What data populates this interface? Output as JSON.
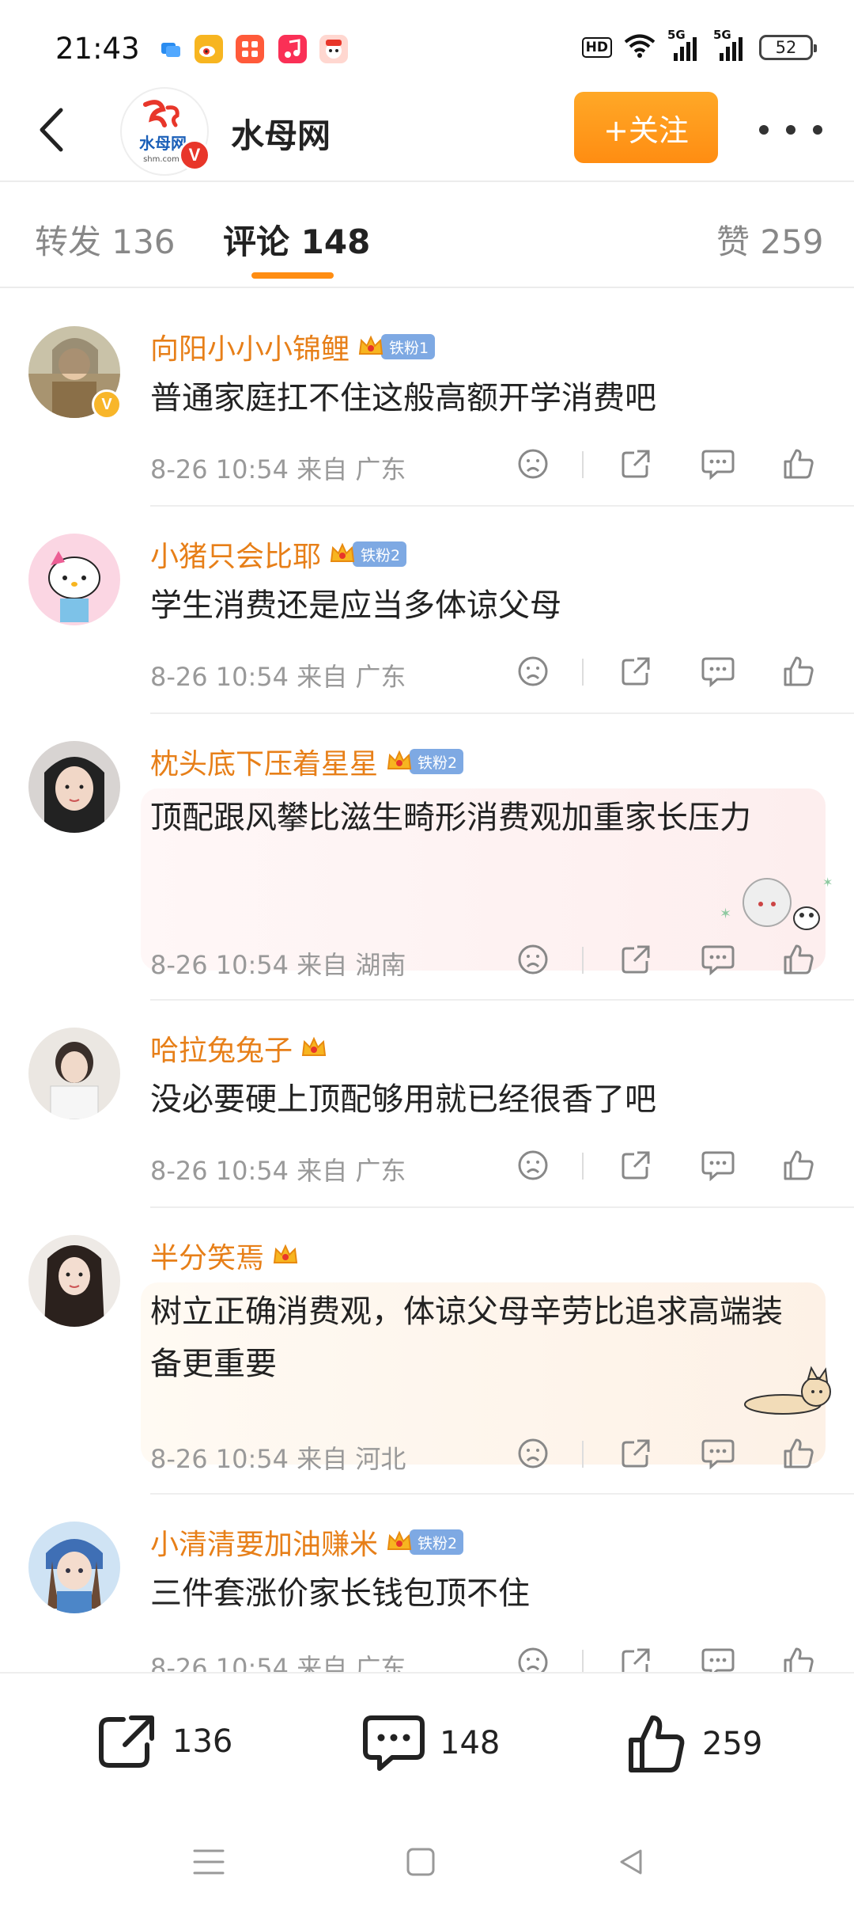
{
  "status_bar": {
    "time": "21:43",
    "hd_label": "HD",
    "signal1_label": "5G",
    "signal2_label": "5G",
    "battery": "52",
    "app_icons": [
      "message-app-icon",
      "weibo-app-icon",
      "grid-app-icon",
      "music-app-icon",
      "game-app-icon"
    ]
  },
  "header": {
    "account_name": "水母网",
    "avatar_text": "水母网",
    "avatar_url_text": "shm.com",
    "verified_mark": "V",
    "follow_label": "+关注"
  },
  "tabs": [
    {
      "label": "转发 136",
      "active": false
    },
    {
      "label": "评论 148",
      "active": true
    },
    {
      "label": "赞 259",
      "active": false
    }
  ],
  "comments": [
    {
      "name": "向阳小小小锦鲤",
      "fan_badge": "铁粉1",
      "text": "普通家庭扛不住这般高额开学消费吧",
      "meta": "8-26 10:54 来自 广东",
      "verified": "V"
    },
    {
      "name": "小猪只会比耶",
      "fan_badge": "铁粉2",
      "text": "学生消费还是应当多体谅父母",
      "meta": "8-26 10:54 来自 广东"
    },
    {
      "name": "枕头底下压着星星",
      "fan_badge": "铁粉2",
      "text": "顶配跟风攀比滋生畸形消费观加重家长压力",
      "meta": "8-26 10:54 来自 湖南"
    },
    {
      "name": "哈拉兔兔子",
      "fan_badge": "",
      "text": "没必要硬上顶配够用就已经很香了吧",
      "meta": "8-26 10:54 来自 广东"
    },
    {
      "name": "半分笑焉",
      "fan_badge": "",
      "text": "树立正确消费观，体谅父母辛劳比追求高端装备更重要",
      "meta": "8-26 10:54 来自 河北"
    },
    {
      "name": "小清清要加油赚米",
      "fan_badge": "铁粉2",
      "text": "三件套涨价家长钱包顶不住",
      "meta": "8-26 10:54 来自 广东"
    }
  ],
  "bottom_bar": {
    "repost_count": "136",
    "comment_count": "148",
    "like_count": "259"
  },
  "colors": {
    "accent": "#ff8d12",
    "username": "#e77f18",
    "fan_badge": "#7ea9e3"
  }
}
